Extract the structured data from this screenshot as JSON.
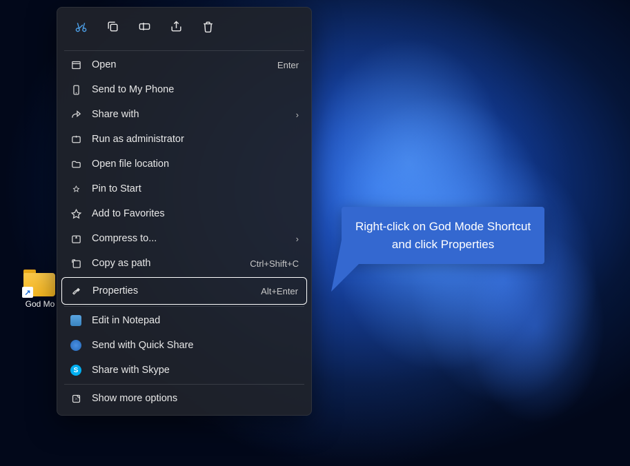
{
  "desktop": {
    "icon_label": "God Mo"
  },
  "toolbar": {
    "cut": "cut-icon",
    "copy": "copy-icon",
    "rename": "rename-icon",
    "share": "share-icon",
    "delete": "delete-icon"
  },
  "menu": {
    "open": {
      "label": "Open",
      "shortcut": "Enter"
    },
    "send_phone": {
      "label": "Send to My Phone"
    },
    "share_with": {
      "label": "Share with"
    },
    "run_admin": {
      "label": "Run as administrator"
    },
    "open_location": {
      "label": "Open file location"
    },
    "pin_start": {
      "label": "Pin to Start"
    },
    "add_favorites": {
      "label": "Add to Favorites"
    },
    "compress": {
      "label": "Compress to..."
    },
    "copy_path": {
      "label": "Copy as path",
      "shortcut": "Ctrl+Shift+C"
    },
    "properties": {
      "label": "Properties",
      "shortcut": "Alt+Enter"
    },
    "edit_notepad": {
      "label": "Edit in Notepad"
    },
    "quick_share": {
      "label": "Send with Quick Share"
    },
    "skype": {
      "label": "Share with Skype"
    },
    "more": {
      "label": "Show more options"
    }
  },
  "callout": {
    "line1": "Right-click on God Mode Shortcut",
    "line2": "and click Properties"
  }
}
